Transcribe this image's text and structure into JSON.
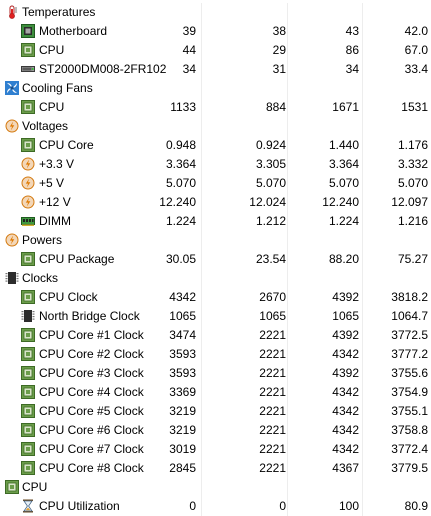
{
  "rows": [
    {
      "kind": "category",
      "icon": "thermometer-icon",
      "name": "Temperatures"
    },
    {
      "kind": "sensor",
      "icon": "motherboard-chip-icon",
      "name": "Motherboard",
      "values": [
        "39",
        "38",
        "43",
        "42.0"
      ]
    },
    {
      "kind": "sensor",
      "icon": "cpu-chip-icon",
      "name": "CPU",
      "values": [
        "44",
        "29",
        "86",
        "67.0"
      ]
    },
    {
      "kind": "sensor",
      "icon": "hard-drive-icon",
      "name": "ST2000DM008-2FR102",
      "values": [
        "34",
        "31",
        "34",
        "33.4"
      ]
    },
    {
      "kind": "category",
      "icon": "fan-icon",
      "name": "Cooling Fans"
    },
    {
      "kind": "sensor",
      "icon": "cpu-chip-icon",
      "name": "CPU",
      "values": [
        "1133",
        "884",
        "1671",
        "1531"
      ]
    },
    {
      "kind": "category",
      "icon": "voltage-icon",
      "name": "Voltages"
    },
    {
      "kind": "sensor",
      "icon": "cpu-chip-icon",
      "name": "CPU Core",
      "values": [
        "0.948",
        "0.924",
        "1.440",
        "1.176"
      ]
    },
    {
      "kind": "sensor",
      "icon": "voltage-icon",
      "name": "+3.3 V",
      "values": [
        "3.364",
        "3.305",
        "3.364",
        "3.332"
      ]
    },
    {
      "kind": "sensor",
      "icon": "voltage-icon",
      "name": "+5 V",
      "values": [
        "5.070",
        "5.070",
        "5.070",
        "5.070"
      ]
    },
    {
      "kind": "sensor",
      "icon": "voltage-icon",
      "name": "+12 V",
      "values": [
        "12.240",
        "12.024",
        "12.240",
        "12.097"
      ]
    },
    {
      "kind": "sensor",
      "icon": "ram-module-icon",
      "name": "DIMM",
      "values": [
        "1.224",
        "1.212",
        "1.224",
        "1.216"
      ]
    },
    {
      "kind": "category",
      "icon": "power-icon",
      "name": "Powers"
    },
    {
      "kind": "sensor",
      "icon": "cpu-chip-icon",
      "name": "CPU Package",
      "values": [
        "30.05",
        "23.54",
        "88.20",
        "75.27"
      ]
    },
    {
      "kind": "category",
      "icon": "clock-chip-icon",
      "name": "Clocks"
    },
    {
      "kind": "sensor",
      "icon": "cpu-chip-icon",
      "name": "CPU Clock",
      "values": [
        "4342",
        "2670",
        "4392",
        "3818.2"
      ]
    },
    {
      "kind": "sensor",
      "icon": "northbridge-icon",
      "name": "North Bridge Clock",
      "values": [
        "1065",
        "1065",
        "1065",
        "1064.7"
      ]
    },
    {
      "kind": "sensor",
      "icon": "cpu-chip-icon",
      "name": "CPU Core #1 Clock",
      "values": [
        "3474",
        "2221",
        "4392",
        "3772.5"
      ]
    },
    {
      "kind": "sensor",
      "icon": "cpu-chip-icon",
      "name": "CPU Core #2 Clock",
      "values": [
        "3593",
        "2221",
        "4342",
        "3777.2"
      ]
    },
    {
      "kind": "sensor",
      "icon": "cpu-chip-icon",
      "name": "CPU Core #3 Clock",
      "values": [
        "3593",
        "2221",
        "4392",
        "3755.6"
      ]
    },
    {
      "kind": "sensor",
      "icon": "cpu-chip-icon",
      "name": "CPU Core #4 Clock",
      "values": [
        "3369",
        "2221",
        "4342",
        "3754.9"
      ]
    },
    {
      "kind": "sensor",
      "icon": "cpu-chip-icon",
      "name": "CPU Core #5 Clock",
      "values": [
        "3219",
        "2221",
        "4342",
        "3755.1"
      ]
    },
    {
      "kind": "sensor",
      "icon": "cpu-chip-icon",
      "name": "CPU Core #6 Clock",
      "values": [
        "3219",
        "2221",
        "4342",
        "3758.8"
      ]
    },
    {
      "kind": "sensor",
      "icon": "cpu-chip-icon",
      "name": "CPU Core #7 Clock",
      "values": [
        "3019",
        "2221",
        "4342",
        "3772.4"
      ]
    },
    {
      "kind": "sensor",
      "icon": "cpu-chip-icon",
      "name": "CPU Core #8 Clock",
      "values": [
        "2845",
        "2221",
        "4367",
        "3779.5"
      ]
    },
    {
      "kind": "category",
      "icon": "cpu-chip-icon",
      "name": "CPU"
    },
    {
      "kind": "sensor",
      "icon": "hourglass-icon",
      "name": "CPU Utilization",
      "values": [
        "0",
        "0",
        "100",
        "80.9"
      ]
    }
  ]
}
